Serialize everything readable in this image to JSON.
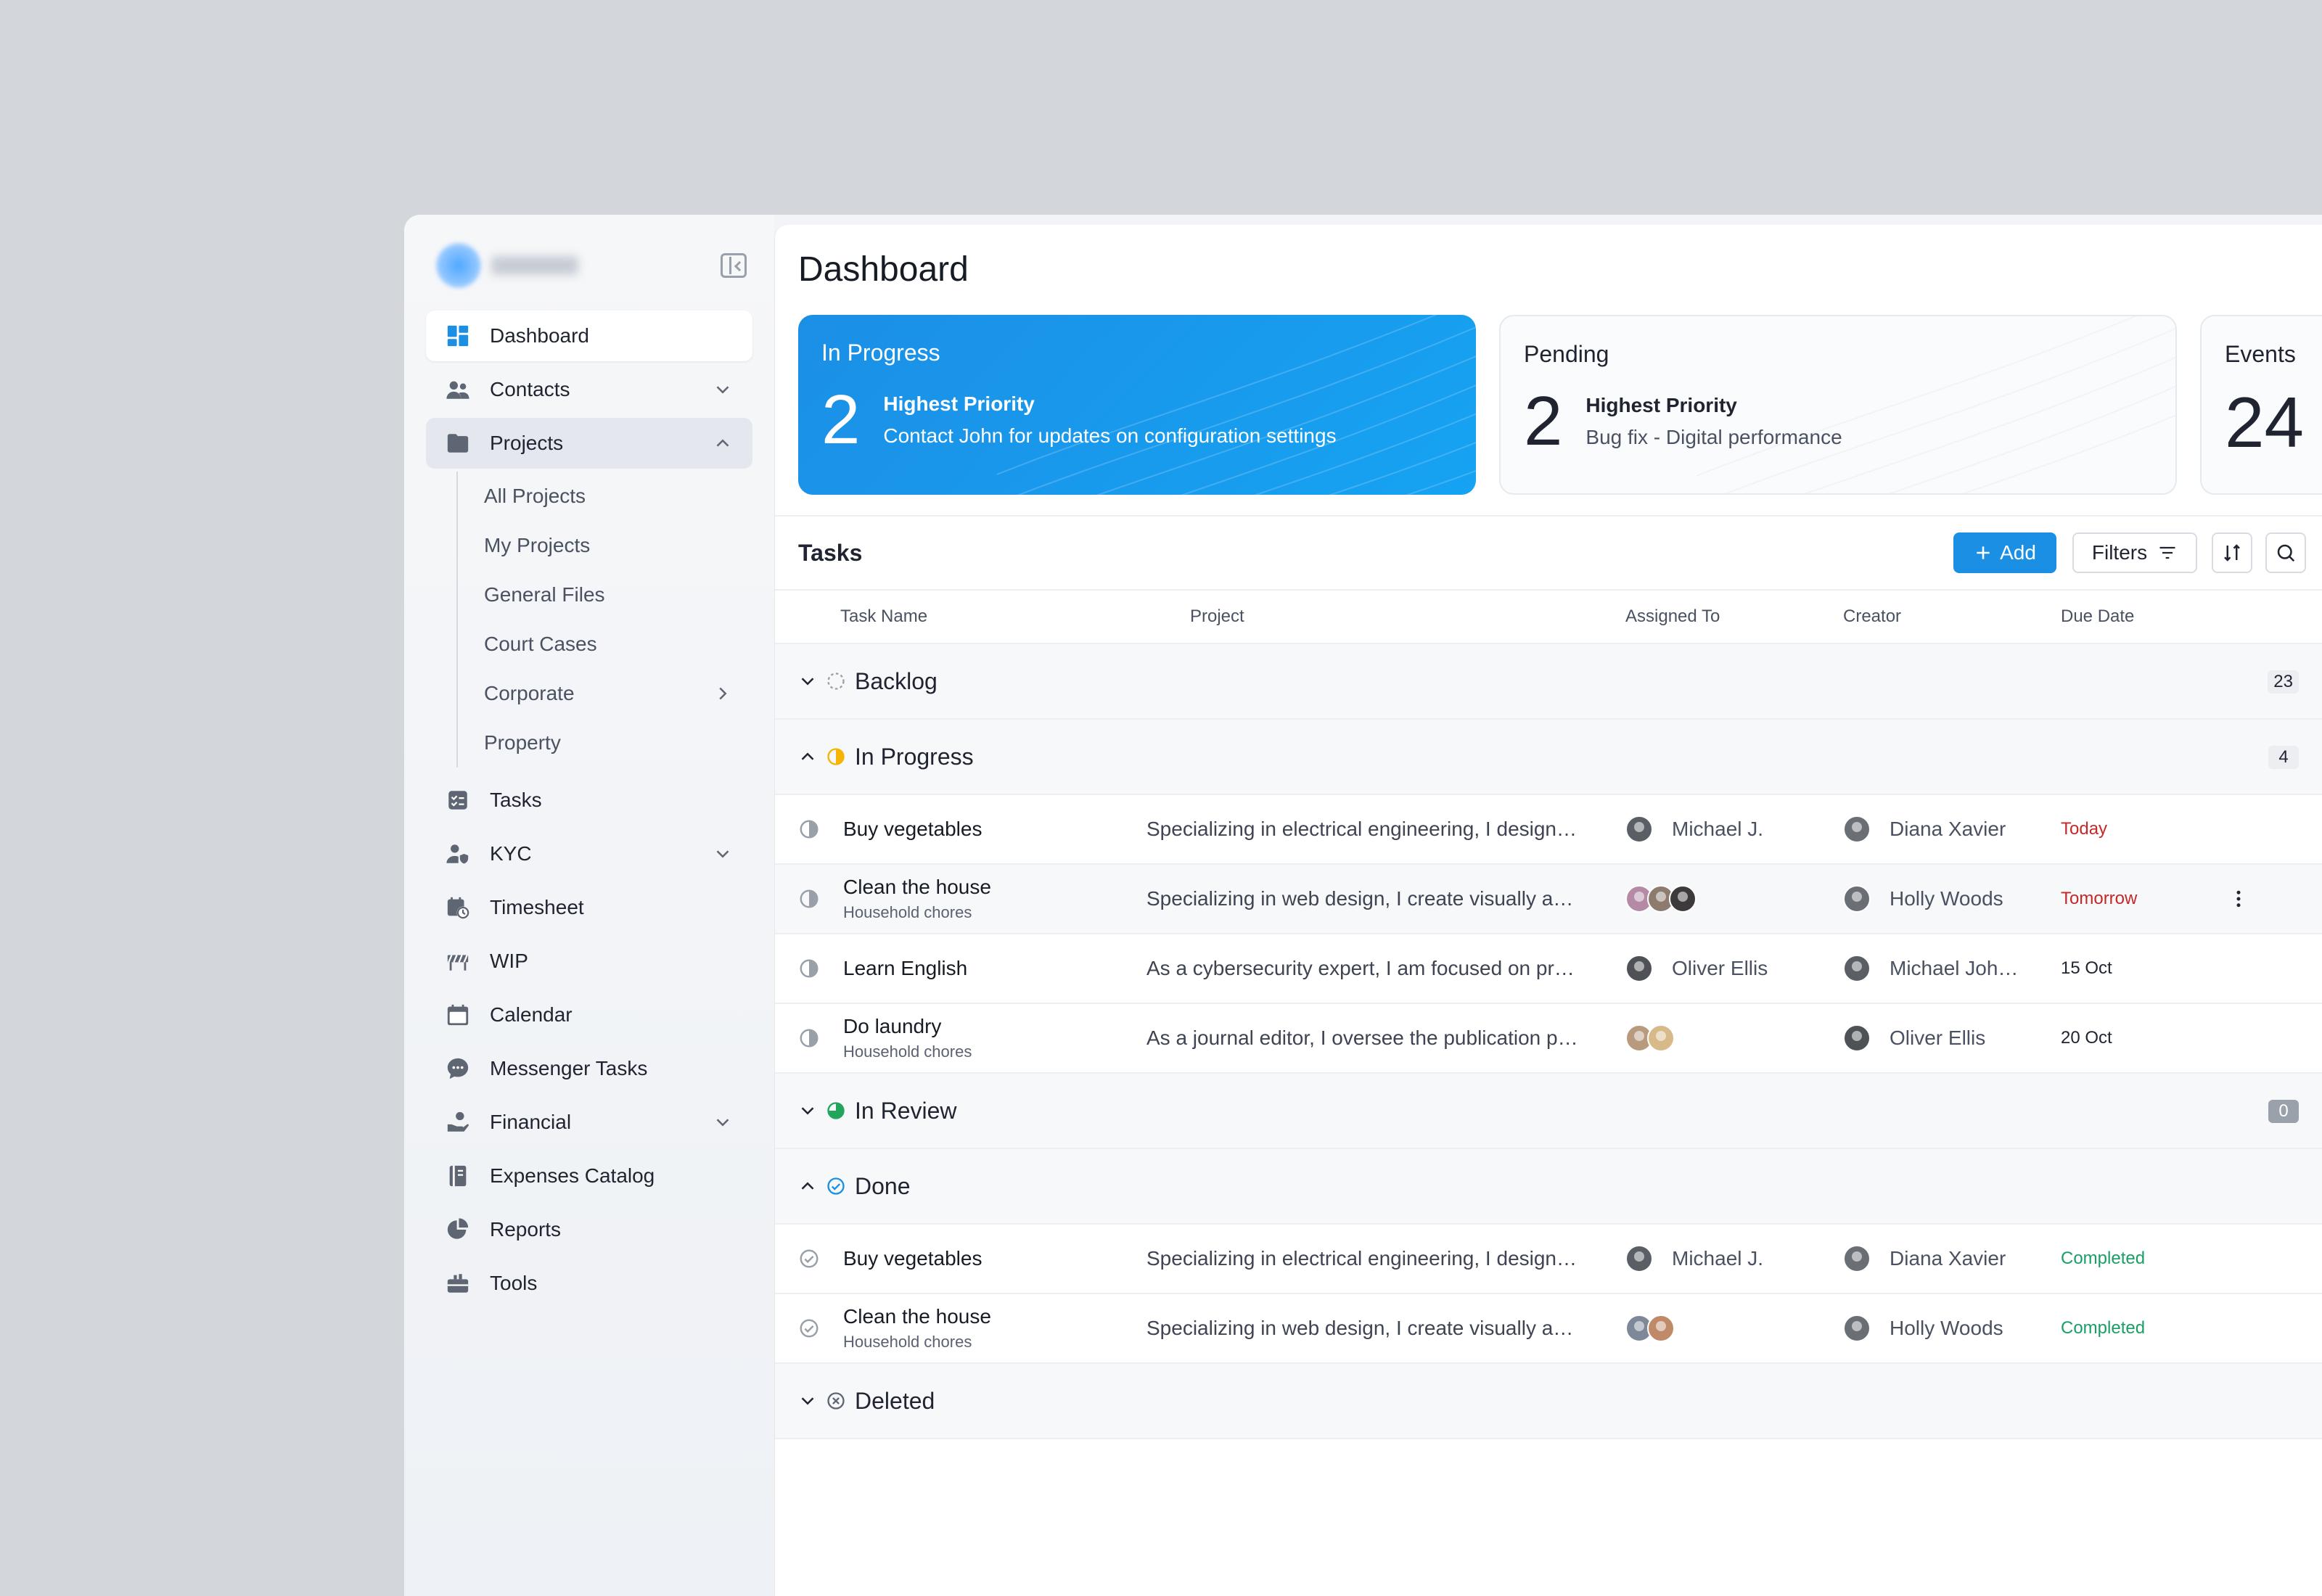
{
  "sidebar": {
    "items": [
      {
        "label": "Dashboard",
        "icon": "grid-icon",
        "active": true
      },
      {
        "label": "Contacts",
        "icon": "users-icon",
        "chevron": "down"
      },
      {
        "label": "Projects",
        "icon": "folder-icon",
        "chevron": "up",
        "open": true
      }
    ],
    "sub_items": [
      {
        "label": "All Projects"
      },
      {
        "label": "My Projects"
      },
      {
        "label": "General Files"
      },
      {
        "label": "Court Cases"
      },
      {
        "label": "Corporate",
        "chevron": "right"
      },
      {
        "label": "Property"
      }
    ],
    "items_after": [
      {
        "label": "Tasks",
        "icon": "checklist-icon"
      },
      {
        "label": "KYC",
        "icon": "user-shield-icon",
        "chevron": "down"
      },
      {
        "label": "Timesheet",
        "icon": "calendar-clock-icon"
      },
      {
        "label": "WIP",
        "icon": "barrier-icon"
      },
      {
        "label": "Calendar",
        "icon": "calendar-icon"
      },
      {
        "label": "Messenger Tasks",
        "icon": "chat-icon"
      },
      {
        "label": "Financial",
        "icon": "hand-coin-icon",
        "chevron": "down"
      },
      {
        "label": "Expenses Catalog",
        "icon": "book-icon"
      },
      {
        "label": "Reports",
        "icon": "pie-icon"
      },
      {
        "label": "Tools",
        "icon": "toolbox-icon"
      }
    ]
  },
  "main": {
    "title": "Dashboard",
    "cards": [
      {
        "title": "In Progress",
        "count": "2",
        "line1": "Highest Priority",
        "line2": "Contact John for updates on configuration settings"
      },
      {
        "title": "Pending",
        "count": "2",
        "line1": "Highest Priority",
        "line2": "Bug fix - Digital performance"
      },
      {
        "title": "Events",
        "count": "24"
      }
    ],
    "tasks": {
      "title": "Tasks",
      "add_label": "Add",
      "filters_label": "Filters"
    },
    "columns": [
      "Task Name",
      "Project",
      "Assigned To",
      "Creator",
      "Due Date"
    ],
    "groups": {
      "backlog": {
        "label": "Backlog",
        "count": "23"
      },
      "in_progress": {
        "label": "In Progress",
        "count": "4"
      },
      "in_review": {
        "label": "In Review",
        "count": "0"
      },
      "done": {
        "label": "Done"
      },
      "deleted": {
        "label": "Deleted"
      }
    },
    "in_progress_rows": [
      {
        "name": "Buy vegetables",
        "sub": "",
        "project": "Specializing in electrical engineering, I design…",
        "assigned": "Michael J.",
        "creator": "Diana Xavier",
        "due": "Today"
      },
      {
        "name": "Clean the house",
        "sub": "Household chores",
        "project": "Specializing in web design, I create visually a…",
        "assigned": "",
        "creator": "Holly Woods",
        "due": "Tomorrow"
      },
      {
        "name": "Learn English",
        "sub": "",
        "project": "As a cybersecurity expert, I am focused on pr…",
        "assigned": "Oliver Ellis",
        "creator": "Michael Joh…",
        "due": "15 Oct"
      },
      {
        "name": "Do laundry",
        "sub": "Household chores",
        "project": "As a journal editor, I oversee the publication p…",
        "assigned": "",
        "creator": "Oliver Ellis",
        "due": "20 Oct"
      }
    ],
    "done_rows": [
      {
        "name": "Buy vegetables",
        "sub": "",
        "project": "Specializing in electrical engineering, I design…",
        "assigned": "Michael J.",
        "creator": "Diana Xavier",
        "due": "Completed"
      },
      {
        "name": "Clean the house",
        "sub": "Household chores",
        "project": "Specializing in web design, I create visually a…",
        "assigned": "",
        "creator": "Holly Woods",
        "due": "Completed"
      }
    ]
  },
  "colors": {
    "accent": "#1a8fe3",
    "due_red": "#c62828",
    "completed_green": "#1b9e66",
    "in_progress_yellow": "#f5b400",
    "in_review_green": "#22a55a",
    "done_blue": "#1a8fe3"
  }
}
